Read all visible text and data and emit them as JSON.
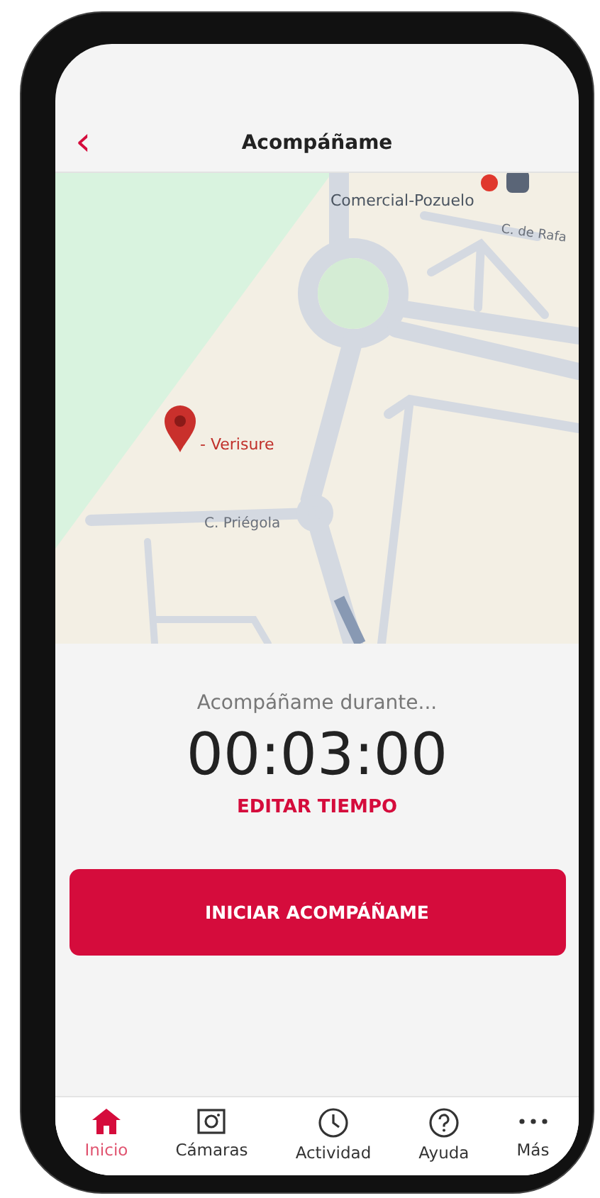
{
  "header": {
    "back_icon": "‹",
    "title": "Acompáñame"
  },
  "map": {
    "labels": [
      {
        "kind": "place",
        "text": "Comercial-Pozuelo"
      },
      {
        "kind": "street",
        "text": "C. de Rafa"
      },
      {
        "kind": "pin",
        "text": "- Verisure"
      },
      {
        "kind": "street",
        "text": "C. Priégola"
      }
    ]
  },
  "timer": {
    "caption": "Acompáñame durante...",
    "time": "00:03:00",
    "edit_link": "EDITAR TIEMPO"
  },
  "start_button": "INICIAR ACOMPÁÑAME",
  "tab_bar": [
    {
      "kind": "home",
      "label": "Inicio",
      "selected": true
    },
    {
      "kind": "camera",
      "label": "Cámaras",
      "selected": false
    },
    {
      "kind": "clock",
      "label": "Actividad",
      "selected": false
    },
    {
      "kind": "help",
      "label": "Ayuda",
      "selected": false
    },
    {
      "kind": "more",
      "label": "Más",
      "selected": false
    }
  ]
}
